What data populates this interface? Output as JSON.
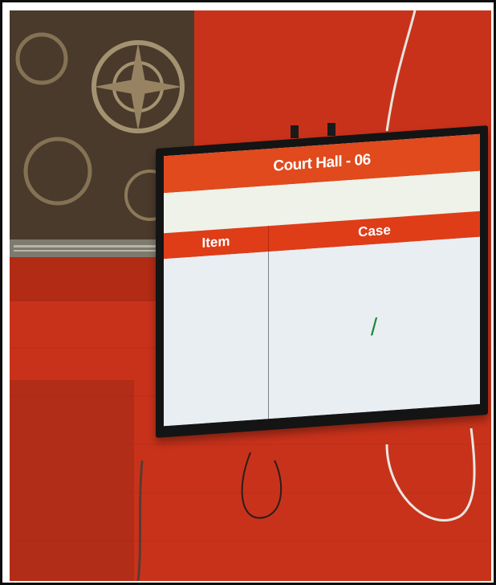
{
  "display": {
    "title": "Court Hall - 06",
    "columns": [
      {
        "label": "Item"
      },
      {
        "label": "Case"
      }
    ],
    "rows": [
      {
        "item": "",
        "case": "/"
      }
    ]
  },
  "colors": {
    "wall_red": "#c7311a",
    "banner_orange": "#e04a1c",
    "screen_bg": "#e9eef2",
    "bezel": "#141414",
    "case_text_green": "#1a8a3a"
  }
}
